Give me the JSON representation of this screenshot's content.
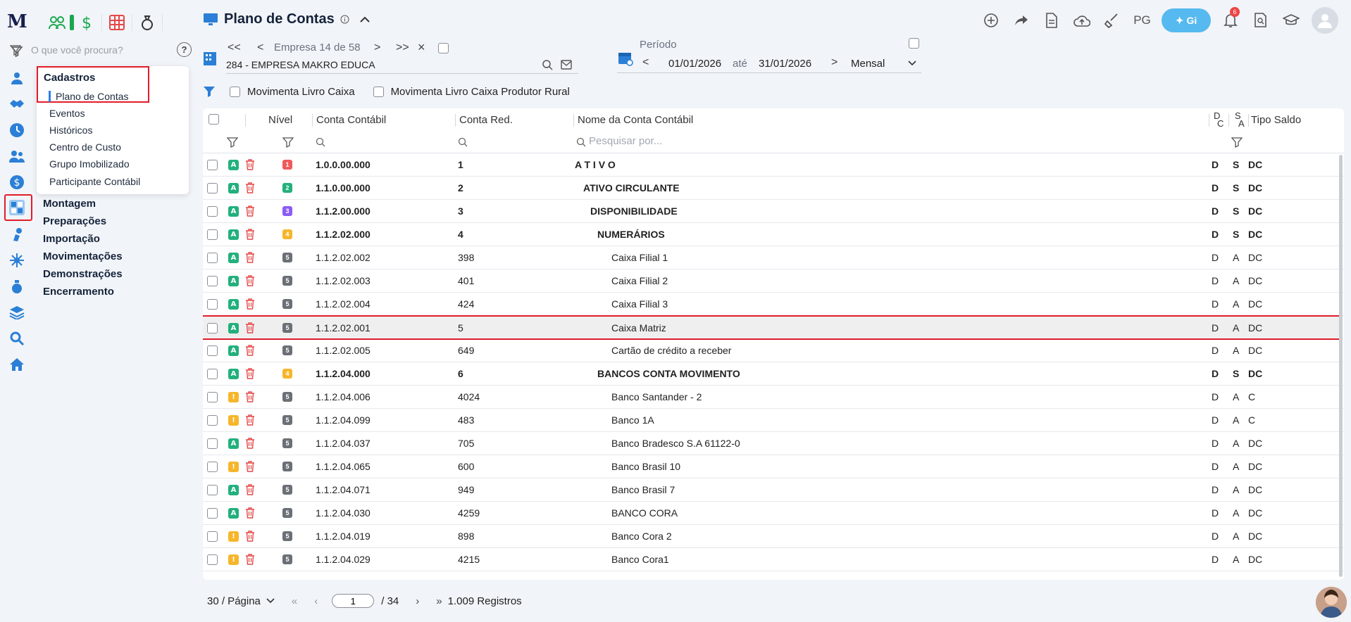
{
  "header": {
    "title": "Plano de Contas",
    "gi_label": "Gi",
    "pg_label": "PG",
    "notifications_count": "6"
  },
  "search": {
    "placeholder": "O que você procura?"
  },
  "submenu": {
    "title": "Cadastros",
    "items": [
      "Plano de Contas",
      "Eventos",
      "Históricos",
      "Centro de Custo",
      "Grupo Imobilizado",
      "Participante Contábil"
    ]
  },
  "nav": [
    "Montagem",
    "Preparações",
    "Importação",
    "Movimentações",
    "Demonstrações",
    "Encerramento"
  ],
  "company": {
    "label": "Empresa 14 de 58",
    "name": "284 - EMPRESA MAKRO EDUCA"
  },
  "period": {
    "label": "Período",
    "start": "01/01/2026",
    "between": "até",
    "end": "31/01/2026",
    "frequency": "Mensal"
  },
  "filters": {
    "livro_caixa": "Movimenta Livro Caixa",
    "livro_caixa_rural": "Movimenta Livro Caixa Produtor Rural"
  },
  "table": {
    "columns": {
      "nivel": "Nível",
      "conta": "Conta Contábil",
      "red": "Conta Red.",
      "nome": "Nome da Conta Contábil",
      "dc_top": "D",
      "dc_bottom": "C",
      "sa_top": "S",
      "sa_bottom": "A",
      "tipo": "Tipo Saldo"
    },
    "search_placeholder": "Pesquisar por...",
    "rows": [
      {
        "status": "A",
        "level": "1",
        "conta": "1.0.0.00.000",
        "red": "1",
        "nome": "A T I V O",
        "dc": "D",
        "sa": "S",
        "tipo": "DC",
        "bold": true
      },
      {
        "status": "A",
        "level": "2",
        "conta": "1.1.0.00.000",
        "red": "2",
        "nome": "ATIVO CIRCULANTE",
        "dc": "D",
        "sa": "S",
        "tipo": "DC",
        "bold": true
      },
      {
        "status": "A",
        "level": "3",
        "conta": "1.1.2.00.000",
        "red": "3",
        "nome": "DISPONIBILIDADE",
        "dc": "D",
        "sa": "S",
        "tipo": "DC",
        "bold": true
      },
      {
        "status": "A",
        "level": "4",
        "conta": "1.1.2.02.000",
        "red": "4",
        "nome": "NUMERÁRIOS",
        "dc": "D",
        "sa": "S",
        "tipo": "DC",
        "bold": true
      },
      {
        "status": "A",
        "level": "5",
        "conta": "1.1.2.02.002",
        "red": "398",
        "nome": "Caixa Filial 1",
        "dc": "D",
        "sa": "A",
        "tipo": "DC",
        "bold": false
      },
      {
        "status": "A",
        "level": "5",
        "conta": "1.1.2.02.003",
        "red": "401",
        "nome": "Caixa Filial 2",
        "dc": "D",
        "sa": "A",
        "tipo": "DC",
        "bold": false
      },
      {
        "status": "A",
        "level": "5",
        "conta": "1.1.2.02.004",
        "red": "424",
        "nome": "Caixa Filial 3",
        "dc": "D",
        "sa": "A",
        "tipo": "DC",
        "bold": false
      },
      {
        "status": "A",
        "level": "5",
        "conta": "1.1.2.02.001",
        "red": "5",
        "nome": "Caixa Matriz",
        "dc": "D",
        "sa": "A",
        "tipo": "DC",
        "bold": false,
        "selected": true
      },
      {
        "status": "A",
        "level": "5",
        "conta": "1.1.2.02.005",
        "red": "649",
        "nome": "Cartão de crédito a receber",
        "dc": "D",
        "sa": "A",
        "tipo": "DC",
        "bold": false
      },
      {
        "status": "A",
        "level": "4",
        "conta": "1.1.2.04.000",
        "red": "6",
        "nome": "BANCOS CONTA MOVIMENTO",
        "dc": "D",
        "sa": "S",
        "tipo": "DC",
        "bold": true
      },
      {
        "status": "!",
        "level": "5",
        "conta": "1.1.2.04.006",
        "red": "4024",
        "nome": "Banco Santander - 2",
        "dc": "D",
        "sa": "A",
        "tipo": "C",
        "bold": false
      },
      {
        "status": "!",
        "level": "5",
        "conta": "1.1.2.04.099",
        "red": "483",
        "nome": "Banco 1A",
        "dc": "D",
        "sa": "A",
        "tipo": "C",
        "bold": false
      },
      {
        "status": "A",
        "level": "5",
        "conta": "1.1.2.04.037",
        "red": "705",
        "nome": "Banco Bradesco S.A 61122-0",
        "dc": "D",
        "sa": "A",
        "tipo": "DC",
        "bold": false
      },
      {
        "status": "!",
        "level": "5",
        "conta": "1.1.2.04.065",
        "red": "600",
        "nome": "Banco Brasil 10",
        "dc": "D",
        "sa": "A",
        "tipo": "DC",
        "bold": false
      },
      {
        "status": "A",
        "level": "5",
        "conta": "1.1.2.04.071",
        "red": "949",
        "nome": "Banco Brasil 7",
        "dc": "D",
        "sa": "A",
        "tipo": "DC",
        "bold": false
      },
      {
        "status": "A",
        "level": "5",
        "conta": "1.1.2.04.030",
        "red": "4259",
        "nome": "BANCO CORA",
        "dc": "D",
        "sa": "A",
        "tipo": "DC",
        "bold": false
      },
      {
        "status": "!",
        "level": "5",
        "conta": "1.1.2.04.019",
        "red": "898",
        "nome": "Banco Cora 2",
        "dc": "D",
        "sa": "A",
        "tipo": "DC",
        "bold": false
      },
      {
        "status": "!",
        "level": "5",
        "conta": "1.1.2.04.029",
        "red": "4215",
        "nome": "Banco Cora1",
        "dc": "D",
        "sa": "A",
        "tipo": "DC",
        "bold": false
      }
    ]
  },
  "pager": {
    "per_page": "30 / Página",
    "page": "1",
    "total_pages": "/ 34",
    "records": "1.009 Registros"
  },
  "colors": {
    "accent": "#2f7ee8",
    "status_active": "#22b07d",
    "status_warning": "#f6b62c",
    "danger": "#e11d2a",
    "level_1": "#f05a5a",
    "level_2": "#22b07d",
    "level_3": "#8b5cf6",
    "level_4": "#f6b62c",
    "level_5": "#6b6f76"
  }
}
